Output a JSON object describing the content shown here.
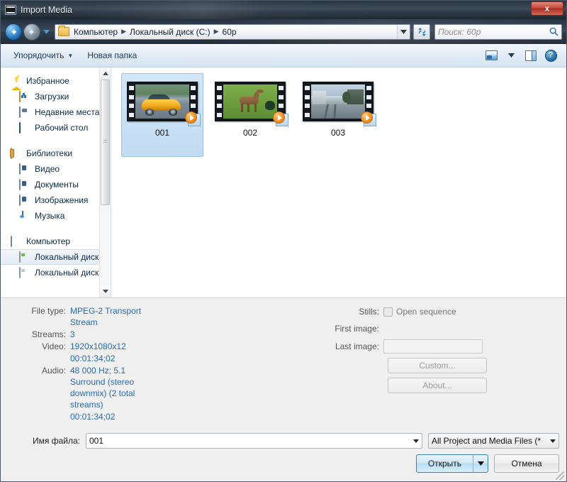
{
  "window": {
    "title": "Import Media",
    "title_icon": "film-strip-icon",
    "close_label": "x"
  },
  "nav": {
    "back_icon": "back-arrow-icon",
    "forward_icon": "forward-arrow-icon",
    "history_icon": "chevron-down-icon",
    "folder_icon": "folder-icon",
    "breadcrumbs": [
      "Компьютер",
      "Локальный диск (C:)",
      "60p"
    ],
    "separator": "▶",
    "dropdown_icon": "chevron-down-icon",
    "refresh_icon": "refresh-icon",
    "search": {
      "placeholder": "Поиск: 60p",
      "icon": "search-icon"
    }
  },
  "toolbar": {
    "organize_label": "Упорядочить",
    "organize_caret": "▼",
    "new_folder_label": "Новая папка",
    "view_icon": "view-mode-icon",
    "view_caret": "▼",
    "preview_pane_icon": "preview-pane-icon",
    "help_icon": "help-icon",
    "help_glyph": "?"
  },
  "sidebar": {
    "groups": [
      {
        "header": {
          "label": "Избранное",
          "icon": "star-icon",
          "icon_class": "ic-star"
        },
        "items": [
          {
            "label": "Загрузки",
            "icon": "downloads-icon",
            "icon_class": "ic-dl",
            "selected": false
          },
          {
            "label": "Недавние места",
            "icon": "recent-places-icon",
            "icon_class": "ic-recent",
            "selected": false
          },
          {
            "label": "Рабочий стол",
            "icon": "desktop-icon",
            "icon_class": "ic-desktop",
            "selected": false
          }
        ]
      },
      {
        "header": {
          "label": "Библиотеки",
          "icon": "libraries-icon",
          "icon_class": "ic-lib"
        },
        "items": [
          {
            "label": "Видео",
            "icon": "video-library-icon",
            "icon_class": "ic-media",
            "selected": false
          },
          {
            "label": "Документы",
            "icon": "documents-library-icon",
            "icon_class": "ic-media",
            "selected": false
          },
          {
            "label": "Изображения",
            "icon": "pictures-library-icon",
            "icon_class": "ic-media",
            "selected": false
          },
          {
            "label": "Музыка",
            "icon": "music-library-icon",
            "icon_class": "ic-music",
            "selected": false
          }
        ]
      },
      {
        "header": {
          "label": "Компьютер",
          "icon": "computer-icon",
          "icon_class": "ic-computer"
        },
        "items": [
          {
            "label": "Локальный диск",
            "icon": "local-disk-icon",
            "icon_class": "ic-disk c",
            "selected": true
          },
          {
            "label": "Локальный диск",
            "icon": "local-disk-icon",
            "icon_class": "ic-disk d",
            "selected": false
          }
        ]
      }
    ],
    "scrollbar": {
      "up_icon": "scroll-up-icon",
      "down_icon": "scroll-down-icon"
    }
  },
  "files": [
    {
      "name": "001",
      "scene": "car",
      "selected": true,
      "play_badge": "play-overlay-icon"
    },
    {
      "name": "002",
      "scene": "antelope",
      "selected": false,
      "play_badge": "play-overlay-icon"
    },
    {
      "name": "003",
      "scene": "street",
      "selected": false,
      "play_badge": "play-overlay-icon"
    }
  ],
  "details": {
    "properties": [
      {
        "label": "File type:",
        "value": "MPEG-2 Transport Stream"
      },
      {
        "label": "Streams:",
        "value": "3"
      },
      {
        "label": "Video:",
        "value": "1920x1080x12"
      },
      {
        "label": "",
        "value": "00:01:34;02"
      },
      {
        "label": "Audio:",
        "value": "48 000 Hz; 5.1 Surround (stereo downmix) (2 total streams)"
      },
      {
        "label": "",
        "value": "00:01:34;02"
      }
    ],
    "stills": {
      "label": "Stills:",
      "checkbox_label": "Open sequence",
      "checked": false
    },
    "first_image": {
      "label": "First image:",
      "value": ""
    },
    "last_image": {
      "label": "Last image:",
      "value": ""
    },
    "custom_button": "Custom...",
    "about_button": "About..."
  },
  "bottom": {
    "filename_label": "Имя файла:",
    "filename_value": "001",
    "filename_caret": "▼",
    "filter_value": "All Project and Media Files (*",
    "filter_caret": "▼",
    "open_label": "Открыть",
    "open_caret": "▼",
    "cancel_label": "Отмена",
    "resize_grip": "resize-grip-icon"
  },
  "colors": {
    "accent_blue": "#2a6bb5",
    "selection_blue": "#c2dcf2",
    "close_red": "#c5483a",
    "titlebar_dark": "#33404d"
  }
}
